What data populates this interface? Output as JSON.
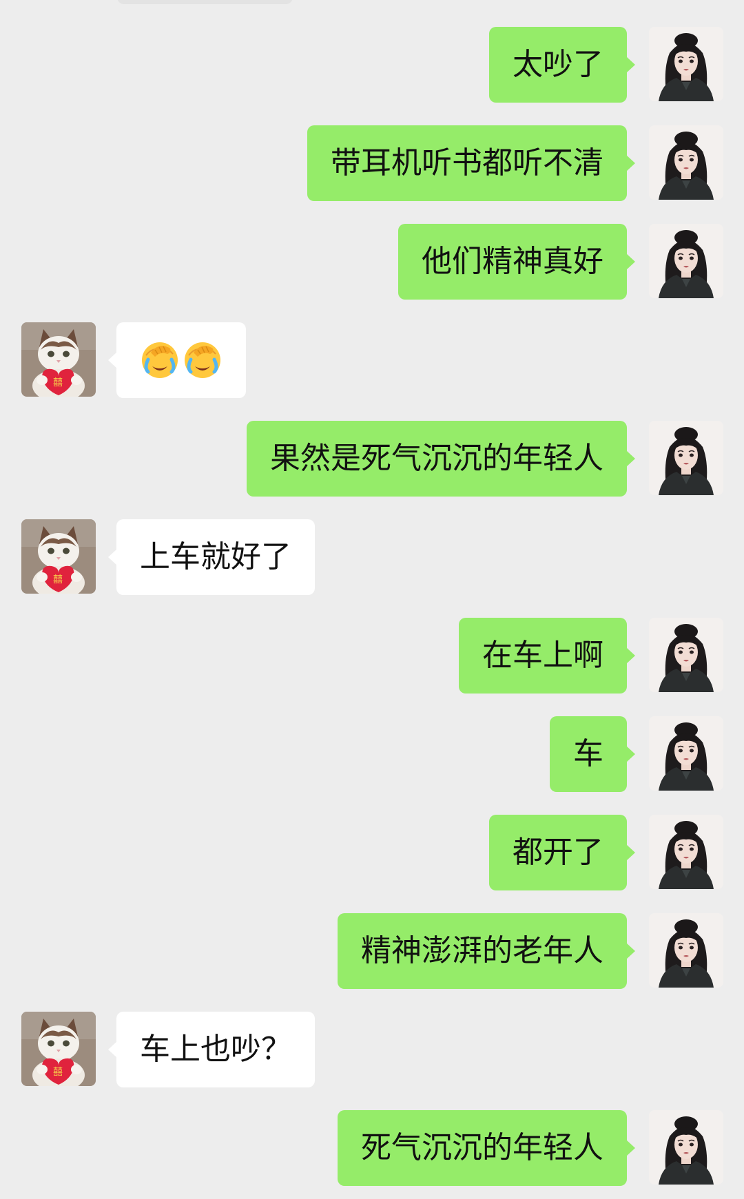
{
  "chat": {
    "messages": [
      {
        "side": "sent",
        "text": "太吵了"
      },
      {
        "side": "sent",
        "text": "带耳机听书都听不清"
      },
      {
        "side": "sent",
        "text": "他们精神真好"
      },
      {
        "side": "recv",
        "emoji": [
          "face-palm-crying-emoji",
          "face-palm-crying-emoji"
        ]
      },
      {
        "side": "sent",
        "text": "果然是死气沉沉的年轻人"
      },
      {
        "side": "recv",
        "text": "上车就好了"
      },
      {
        "side": "sent",
        "text": "在车上啊"
      },
      {
        "side": "sent",
        "text": "车"
      },
      {
        "side": "sent",
        "text": "都开了"
      },
      {
        "side": "sent",
        "text": "精神澎湃的老年人"
      },
      {
        "side": "recv",
        "text": "车上也吵？"
      },
      {
        "side": "sent",
        "text": "死气沉沉的年轻人"
      }
    ]
  },
  "avatars": {
    "self": "girl-avatar-icon",
    "other": "cat-avatar-icon"
  },
  "colors": {
    "background": "#EDEDED",
    "sent_bubble": "#95EC69",
    "recv_bubble": "#FFFFFF",
    "text": "#111111"
  }
}
